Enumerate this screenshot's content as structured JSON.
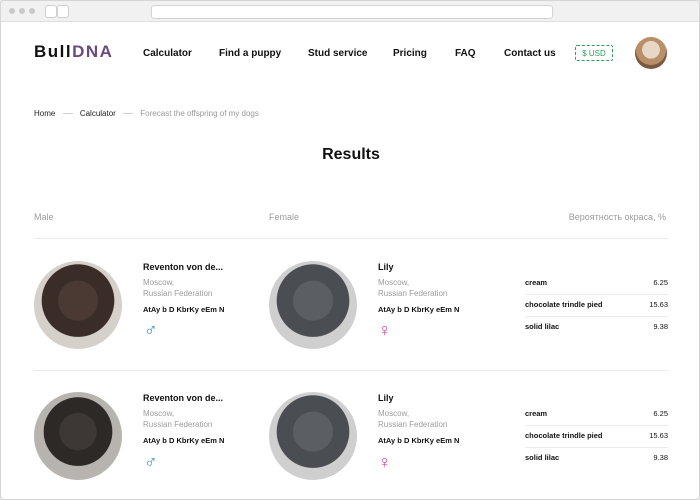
{
  "header": {
    "logo_main": "Bull",
    "logo_accent": "DNA",
    "menu": [
      "Calculator",
      "Find a puppy",
      "Stud service",
      "Pricing",
      "FAQ",
      "Contact us"
    ],
    "currency": "$ USD"
  },
  "breadcrumb": [
    "Home",
    "Calculator",
    "Forecast the offspring of my dogs"
  ],
  "page_title": "Results",
  "columns": {
    "male": "Male",
    "female": "Female",
    "probability": "Вероятность окраса, %"
  },
  "results": [
    {
      "male": {
        "name": "Reventon von de...",
        "city": "Moscow,",
        "country": "Russian Federation",
        "genotype": "AtAy b D KbrKy eEm N",
        "sex_symbol": "♂"
      },
      "female": {
        "name": "Lily",
        "city": "Moscow,",
        "country": "Russian Federation",
        "genotype": "AtAy b D KbrKy eEm N",
        "sex_symbol": "♀"
      },
      "probabilities": [
        {
          "label": "cream",
          "value": "6.25"
        },
        {
          "label": "chocolate trindle pied",
          "value": "15.63"
        },
        {
          "label": "solid lilac",
          "value": "9.38"
        }
      ]
    },
    {
      "male": {
        "name": "Reventon von de...",
        "city": "Moscow,",
        "country": "Russian Federation",
        "genotype": "AtAy b D KbrKy eEm N",
        "sex_symbol": "♂"
      },
      "female": {
        "name": "Lily",
        "city": "Moscow,",
        "country": "Russian Federation",
        "genotype": "AtAy b D KbrKy eEm N",
        "sex_symbol": "♀"
      },
      "probabilities": [
        {
          "label": "cream",
          "value": "6.25"
        },
        {
          "label": "chocolate trindle pied",
          "value": "15.63"
        },
        {
          "label": "solid lilac",
          "value": "9.38"
        }
      ]
    }
  ],
  "colors": {
    "logo_accent": "#6b4a83",
    "currency": "#2e9f5b",
    "male_symbol": "#3c8fd6",
    "female_symbol": "#d24d9b"
  }
}
